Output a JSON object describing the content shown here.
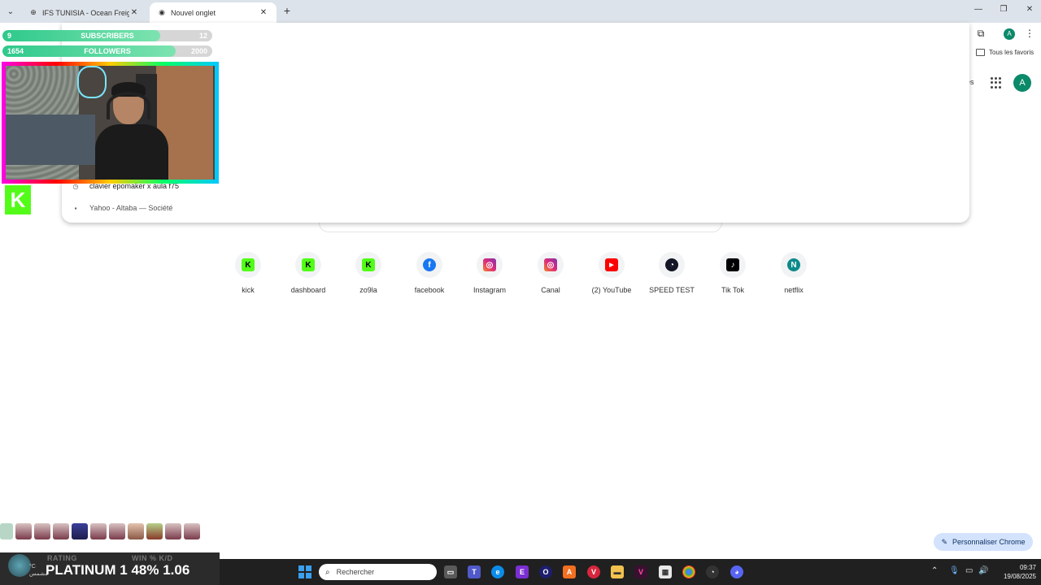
{
  "browser": {
    "tabs": [
      {
        "title": "IFS TUNISIA - Ocean Freight, Ai",
        "active": false
      },
      {
        "title": "Nouvel onglet",
        "active": true
      }
    ],
    "bookmarks_all_label": "Tous les favoris",
    "profile_initial": "A"
  },
  "omnibox": {
    "suggestions": [
      {
        "text": "clavier epomaker x aula f75",
        "icon": "history-icon"
      },
      {
        "text": "Yahoo - Altaba — Société",
        "icon": "site-icon"
      }
    ]
  },
  "ntp": {
    "images_partial": "es",
    "profile_initial": "A",
    "shortcuts": [
      {
        "label": "kick",
        "icon": "kick-icon",
        "color": "#53fc18",
        "glyph": "K"
      },
      {
        "label": "dashboard",
        "icon": "kick-icon",
        "color": "#53fc18",
        "glyph": "K"
      },
      {
        "label": "zo9la",
        "icon": "kick-icon",
        "color": "#53fc18",
        "glyph": "K"
      },
      {
        "label": "facebook",
        "icon": "facebook-icon",
        "color": "#1877f2",
        "glyph": "f"
      },
      {
        "label": "Instagram",
        "icon": "instagram-icon",
        "color": "#e1306c",
        "glyph": "◎"
      },
      {
        "label": "Canal",
        "icon": "instagram-icon",
        "color": "#e1306c",
        "glyph": "◎"
      },
      {
        "label": "(2) YouTube",
        "icon": "youtube-icon",
        "color": "#ff0000",
        "glyph": "▶"
      },
      {
        "label": "SPEED TEST",
        "icon": "speedtest-icon",
        "color": "#141526",
        "glyph": "◔"
      },
      {
        "label": "Tik Tok",
        "icon": "tiktok-icon",
        "color": "#000000",
        "glyph": "♪"
      },
      {
        "label": "netflix",
        "icon": "netflix-letter-icon",
        "color": "#0b8a8a",
        "glyph": "N"
      }
    ],
    "customize_label": "Personnaliser Chrome"
  },
  "overlay": {
    "subscribers": {
      "current": "9",
      "label": "SUBSCRIBERS",
      "goal": "12",
      "progress": 0.75
    },
    "followers": {
      "current": "1654",
      "label": "FOLLOWERS",
      "goal": "2000",
      "progress": 0.827
    },
    "rank_labels": {
      "rating": "RATING",
      "winkd": "WIN % K/D"
    },
    "rank_value": "PLATINUM 1 48% 1.06",
    "weather": {
      "temp": "°C",
      "desc": "مشمس"
    },
    "hero_count": 11
  },
  "taskbar": {
    "search_placeholder": "Rechercher",
    "time": "09:37",
    "date": "19/08/2025"
  }
}
